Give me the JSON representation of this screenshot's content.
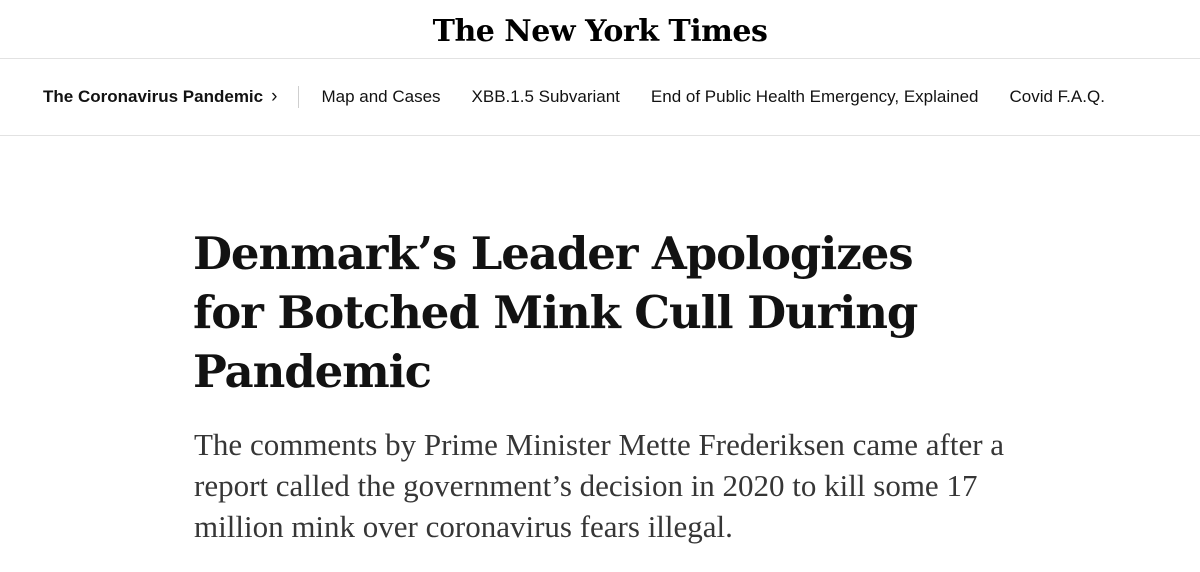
{
  "masthead": {
    "logo_text": "The New York Times"
  },
  "section_nav": {
    "main_label": "The Coronavirus Pandemic",
    "chevron": "›",
    "links": [
      {
        "label": "Map and Cases"
      },
      {
        "label": "XBB.1.5 Subvariant"
      },
      {
        "label": "End of Public Health Emergency, Explained"
      },
      {
        "label": "Covid F.A.Q."
      }
    ]
  },
  "article": {
    "headline": "Denmark’s Leader Apologizes for Botched Mink Cull During Pandemic",
    "summary": "The comments by Prime Minister Mette Frederiksen came after a report called the government’s decision in 2020 to kill some 17 million mink over coronavirus fears illegal."
  },
  "colors": {
    "text": "#121212",
    "summary_text": "#363636",
    "rule": "#e2e2e2",
    "background": "#ffffff"
  }
}
